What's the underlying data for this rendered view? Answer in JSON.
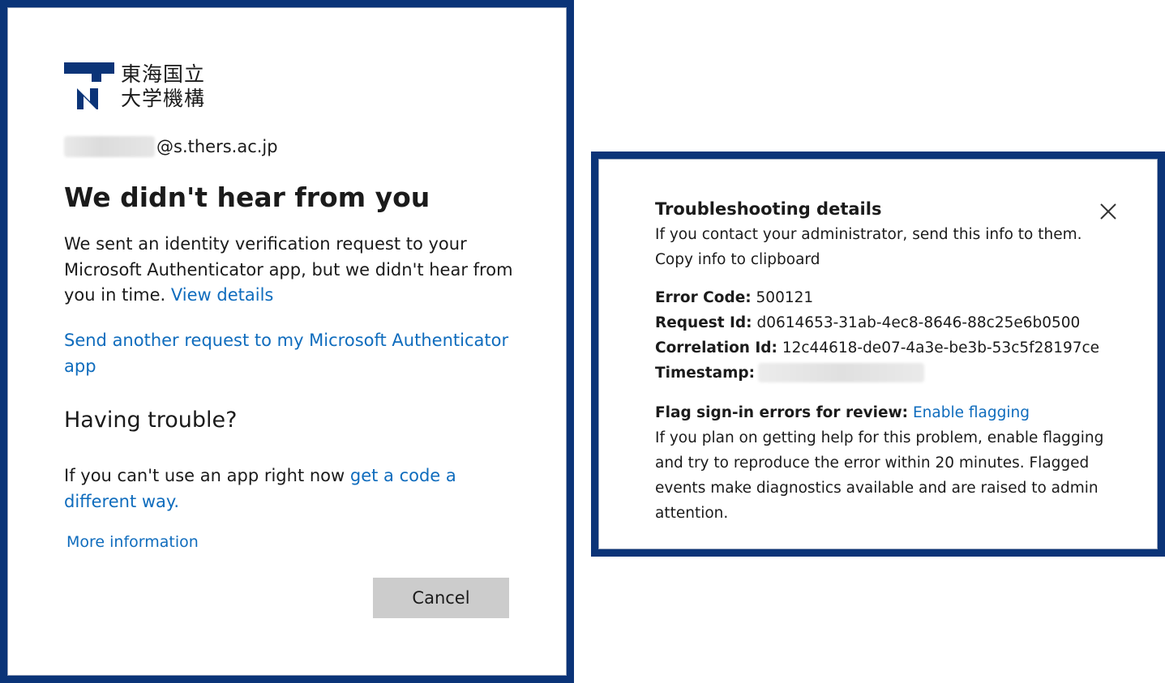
{
  "left": {
    "logo_line1": "東海国立",
    "logo_line2": "大学機構",
    "account_domain": "@s.thers.ac.jp",
    "title": "We didn't hear from you",
    "body_text": "We sent an identity verification request to your Microsoft Authenticator app, but we didn't hear from you in time.",
    "view_details": "View details",
    "send_request": "Send another request to my Microsoft Authenticator app",
    "having_trouble": "Having trouble?",
    "cant_use": "If you can't use an app right now",
    "get_code": "get a code a different way.",
    "more_information": "More information",
    "cancel": "Cancel"
  },
  "right": {
    "title": "Troubleshooting details",
    "subtitle": "If you contact your administrator, send this info to them.",
    "copy_link": "Copy info to clipboard",
    "error_code_label": "Error Code:",
    "error_code": "500121",
    "request_id_label": "Request Id:",
    "request_id": "d0614653-31ab-4ec8-8646-88c25e6b0500",
    "correlation_id_label": "Correlation Id:",
    "correlation_id": "12c44618-de07-4a3e-be3b-53c5f28197ce",
    "timestamp_label": "Timestamp:",
    "flag_label": "Flag sign-in errors for review:",
    "enable_flagging": "Enable flagging",
    "flag_description": "If you plan on getting help for this problem, enable flagging and try to reproduce the error within 20 minutes. Flagged events make diagnostics available and are raised to admin attention."
  },
  "colors": {
    "frame": "#0b3478",
    "link": "#0f6cbd",
    "logo": "#0b3478",
    "button_bg": "#cccccc"
  }
}
